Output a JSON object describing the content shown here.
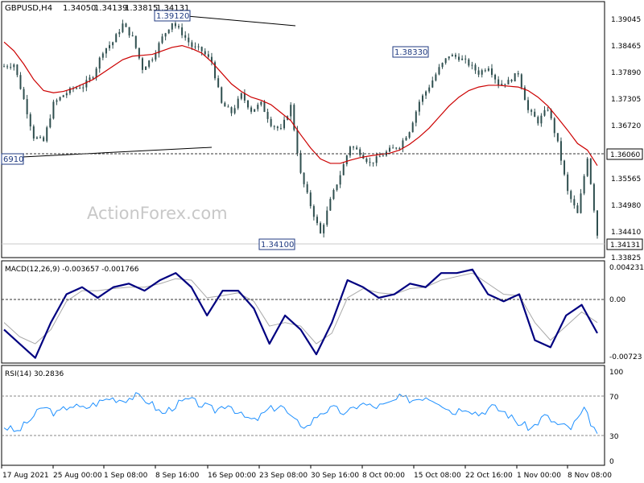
{
  "watermark": "ActionForex.com",
  "price_panel": {
    "symbol_label": "GBPUSD,H4",
    "ohlc": [
      "1.34050",
      "1.34139",
      "1.33815",
      "1.34131"
    ],
    "y_ticks": [
      "1.39045",
      "1.38465",
      "1.37890",
      "1.37305",
      "1.36720",
      "1.36060",
      "1.35565",
      "1.34980",
      "1.34410",
      "1.34131",
      "1.33825"
    ],
    "horizontal_line_label": "1.36060",
    "last_price_label": "1.34131",
    "annotations": [
      "1.39120",
      "1.38330",
      "1.34100",
      "6910"
    ]
  },
  "macd_panel": {
    "label": "MACD(12,26,9) -0.003657 -0.001766",
    "y_ticks": [
      "0.004231",
      "0.00",
      "-0.00723"
    ]
  },
  "rsi_panel": {
    "label": "RSI(14) 30.2836",
    "y_ticks": [
      "100",
      "70",
      "30",
      "0"
    ]
  },
  "x_ticks": [
    "17 Aug 2021",
    "25 Aug 00:00",
    "1 Sep 08:00",
    "8 Sep 16:00",
    "16 Sep 00:00",
    "23 Sep 08:00",
    "30 Sep 16:00",
    "8 Oct 00:00",
    "15 Oct 08:00",
    "22 Oct 16:00",
    "1 Nov 00:00",
    "8 Nov 08:00"
  ],
  "colors": {
    "candles": "#2f4f4f",
    "moving_average": "#cc0000",
    "trend_lines": "#000000",
    "macd_line": "#000080",
    "signal_line": "#a9a9a9",
    "rsi_line": "#1e90ff",
    "dotted_levels": "#333333"
  },
  "chart_data": [
    {
      "type": "candlestick",
      "title": "GBPUSD,H4",
      "ylim": [
        1.3365,
        1.3938
      ],
      "series": [
        {
          "name": "close",
          "values": [
            1.3795,
            1.38,
            1.372,
            1.3635,
            1.3625,
            1.371,
            1.373,
            1.3745,
            1.375,
            1.3775,
            1.383,
            1.385,
            1.389,
            1.386,
            1.379,
            1.3815,
            1.386,
            1.3895,
            1.387,
            1.384,
            1.383,
            1.3805,
            1.371,
            1.369,
            1.373,
            1.3695,
            1.371,
            1.3665,
            1.365,
            1.3705,
            1.355,
            1.348,
            1.3415,
            1.349,
            1.355,
            1.3615,
            1.36,
            1.3575,
            1.359,
            1.3605,
            1.3615,
            1.365,
            1.3715,
            1.375,
            1.379,
            1.382,
            1.3815,
            1.38,
            1.378,
            1.3795,
            1.3755,
            1.376,
            1.378,
            1.3695,
            1.367,
            1.37,
            1.362,
            1.351,
            1.346,
            1.359,
            1.3413
          ]
        },
        {
          "name": "moving average",
          "values": [
            1.385,
            1.383,
            1.38,
            1.3765,
            1.374,
            1.3735,
            1.3738,
            1.3745,
            1.3755,
            1.3765,
            1.378,
            1.3795,
            1.381,
            1.3818,
            1.382,
            1.3822,
            1.383,
            1.3838,
            1.3842,
            1.3835,
            1.3825,
            1.3805,
            1.378,
            1.3755,
            1.3738,
            1.3725,
            1.3718,
            1.3708,
            1.369,
            1.3672,
            1.364,
            1.361,
            1.3585,
            1.3575,
            1.3575,
            1.3582,
            1.3588,
            1.3592,
            1.3595,
            1.3598,
            1.3605,
            1.3618,
            1.3635,
            1.3655,
            1.368,
            1.3705,
            1.3725,
            1.374,
            1.3748,
            1.3752,
            1.3752,
            1.375,
            1.3748,
            1.374,
            1.3725,
            1.3705,
            1.3678,
            1.365,
            1.362,
            1.3605,
            1.357
          ]
        }
      ]
    },
    {
      "type": "line",
      "title": "MACD(12,26,9)",
      "ylim": [
        -0.0085,
        0.0055
      ],
      "series": [
        {
          "name": "MACD",
          "values": [
            -0.004,
            -0.006,
            -0.008,
            -0.003,
            0.001,
            0.002,
            0.0005,
            0.002,
            0.0025,
            0.0015,
            0.003,
            0.004,
            0.002,
            -0.002,
            0.0015,
            0.0015,
            -0.001,
            -0.006,
            -0.002,
            -0.004,
            -0.0075,
            -0.003,
            0.003,
            0.002,
            0.0005,
            0.001,
            0.0025,
            0.002,
            0.004,
            0.004,
            0.0045,
            0.001,
            0.0,
            0.001,
            -0.0055,
            -0.0065,
            -0.002,
            -0.0005,
            -0.0045
          ]
        },
        {
          "name": "signal",
          "values": [
            -0.003,
            -0.005,
            -0.006,
            -0.004,
            0.0,
            0.0015,
            0.0015,
            0.0018,
            0.002,
            0.002,
            0.0025,
            0.0032,
            0.003,
            0.0005,
            0.0008,
            0.0012,
            0.0,
            -0.0035,
            -0.003,
            -0.0035,
            -0.006,
            -0.0045,
            0.0005,
            0.0018,
            0.0012,
            0.001,
            0.0018,
            0.002,
            0.003,
            0.0035,
            0.004,
            0.0025,
            0.001,
            0.0008,
            -0.003,
            -0.0055,
            -0.0035,
            -0.0015,
            -0.003
          ]
        }
      ]
    },
    {
      "type": "line",
      "title": "RSI(14)",
      "ylim": [
        0,
        100
      ],
      "series": [
        {
          "name": "RSI",
          "values": [
            38,
            32,
            46,
            60,
            52,
            62,
            58,
            64,
            70,
            68,
            72,
            66,
            52,
            62,
            68,
            62,
            56,
            64,
            50,
            44,
            56,
            62,
            44,
            38,
            54,
            58,
            52,
            64,
            60,
            62,
            70,
            68,
            72,
            66,
            54,
            60,
            52,
            60,
            54,
            42,
            36,
            50,
            40,
            36,
            56,
            30
          ]
        }
      ]
    }
  ]
}
